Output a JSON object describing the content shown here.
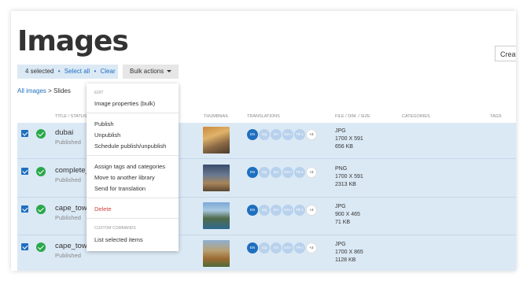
{
  "header": {
    "title": "Images",
    "create_label": "Creat"
  },
  "selection": {
    "count_text": "4 selected",
    "select_all": "Select all",
    "clear": "Clear",
    "bullet": "•"
  },
  "bulk": {
    "label": "Bulk actions"
  },
  "breadcrumb": {
    "root": "All images",
    "sep": ">",
    "current": "Slides"
  },
  "columns": {
    "title_status": "TITLE / STATUS",
    "thumbnail": "THUMBNAIL",
    "translations": "TRANSLATIONS",
    "file": "FILE / DIM. / SIZE",
    "categories": "CATEGORIES",
    "tags": "TAGS"
  },
  "rows": [
    {
      "title": "dubai",
      "status": "Published",
      "file_type": "JPG",
      "dims": "1700 X 591",
      "size": "656 KB"
    },
    {
      "title": "complete_",
      "status": "Published",
      "file_type": "PNG",
      "dims": "1700 X 591",
      "size": "2313 KB"
    },
    {
      "title": "cape_town",
      "status": "Published",
      "file_type": "JPG",
      "dims": "900 X 465",
      "size": "71 KB"
    },
    {
      "title": "cape_town",
      "status": "Published",
      "file_type": "JPG",
      "dims": "1700 X 865",
      "size": "1128 KB"
    }
  ],
  "translations": {
    "codes": [
      "EN",
      "SQ",
      "DA",
      "DG-I",
      "TR-1"
    ],
    "more": "+2"
  },
  "menu": {
    "edit_label": "EDIT",
    "image_properties": "Image properties (bulk)",
    "publish": "Publish",
    "unpublish": "Unpublish",
    "schedule": "Schedule publish/unpublish",
    "assign": "Assign tags and categories",
    "move": "Move to another library",
    "send": "Send for translation",
    "delete": "Delete",
    "custom_label": "CUSTOM COMMANDS",
    "list": "List selected items"
  },
  "colors": {
    "accent": "#1f6fbf",
    "selected_row": "#dbe9f5",
    "success": "#2aa84a",
    "danger": "#d04040"
  }
}
